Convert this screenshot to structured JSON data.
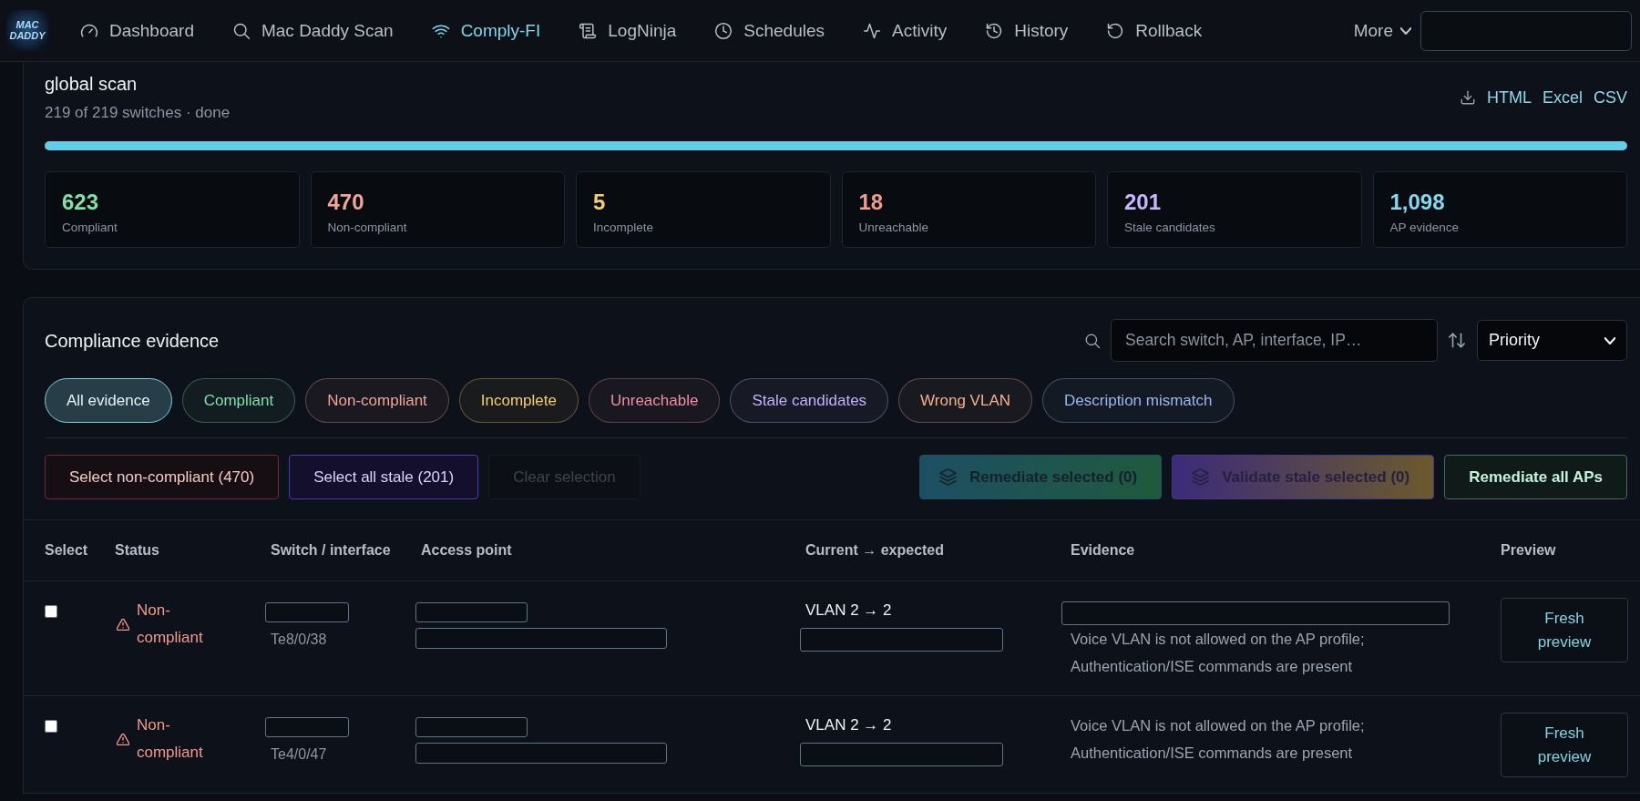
{
  "nav": {
    "logo": "MAC DADDY",
    "items": [
      {
        "label": "Dashboard",
        "selected": false
      },
      {
        "label": "Mac Daddy Scan",
        "selected": false
      },
      {
        "label": "Comply-FI",
        "selected": true
      },
      {
        "label": "LogNinja",
        "selected": false
      },
      {
        "label": "Schedules",
        "selected": false
      },
      {
        "label": "Activity",
        "selected": false
      },
      {
        "label": "History",
        "selected": false
      },
      {
        "label": "Rollback",
        "selected": false
      }
    ],
    "more": "More"
  },
  "scan": {
    "title": "global scan",
    "subtitle": "219 of 219 switches · done",
    "progress": {
      "level": 1
    },
    "exports": [
      "HTML",
      "Excel",
      "CSV"
    ],
    "stats": [
      {
        "value": "623",
        "label": "Compliant",
        "color": "#7ee2a8"
      },
      {
        "value": "470",
        "label": "Non-compliant",
        "color": "#f3a698"
      },
      {
        "value": "5",
        "label": "Incomplete",
        "color": "#f6d06c"
      },
      {
        "value": "18",
        "label": "Unreachable",
        "color": "#f49c8c"
      },
      {
        "value": "201",
        "label": "Stale candidates",
        "color": "#c9b6ff"
      },
      {
        "value": "1,098",
        "label": "AP evidence",
        "color": "#82d9f0"
      }
    ]
  },
  "evidence": {
    "title": "Compliance evidence",
    "search": {
      "placeholder": "Search switch, AP, interface, IP…"
    },
    "sort": {
      "value": "Priority"
    },
    "filters": [
      {
        "label": "All evidence",
        "color": "#7fcfe0",
        "selected": true
      },
      {
        "label": "Compliant",
        "color": "#7ee2a8",
        "selected": false
      },
      {
        "label": "Non-compliant",
        "color": "#f0a499",
        "selected": false
      },
      {
        "label": "Incomplete",
        "color": "#f5cd6a",
        "selected": false
      },
      {
        "label": "Unreachable",
        "color": "#f08fa0",
        "selected": false
      },
      {
        "label": "Stale candidates",
        "color": "#c3b0ff",
        "selected": false
      },
      {
        "label": "Wrong VLAN",
        "color": "#f5b08a",
        "selected": false
      },
      {
        "label": "Description mismatch",
        "color": "#9ab8f0",
        "selected": false
      }
    ],
    "actions": [
      {
        "label": "Select non-compliant (470)",
        "kind": "danger",
        "disabled": false
      },
      {
        "label": "Select all stale (201)",
        "kind": "stale",
        "disabled": false
      },
      {
        "label": "Clear selection",
        "kind": "plain",
        "disabled": true
      },
      {
        "label": "Remediate selected (0)",
        "kind": "remediate",
        "disabled": true
      },
      {
        "label": "Validate stale selected (0)",
        "kind": "validate",
        "disabled": true
      },
      {
        "label": "Remediate all APs",
        "kind": "primary",
        "disabled": false
      }
    ],
    "table": {
      "columns": [
        "Select",
        "Status",
        "Switch / interface",
        "Access point",
        "Current → expected",
        "Evidence",
        "Preview"
      ],
      "rows": [
        {
          "selected": false,
          "status": {
            "kind": "noncompliant",
            "label": "Non-compliant"
          },
          "interface": "Te8/0/38",
          "current": "VLAN 2 → 2",
          "evidence": {
            "redacted": true,
            "text": "Voice VLAN is not allowed on the AP profile; Authentication/ISE commands are present"
          },
          "preview": "Fresh preview"
        },
        {
          "selected": false,
          "status": {
            "kind": "noncompliant",
            "label": "Non-compliant"
          },
          "interface": "Te4/0/47",
          "current": "VLAN 2 → 2",
          "evidence": {
            "redacted": false,
            "text": "Voice VLAN is not allowed on the AP profile; Authentication/ISE commands are present"
          },
          "preview": "Fresh preview"
        }
      ]
    }
  }
}
